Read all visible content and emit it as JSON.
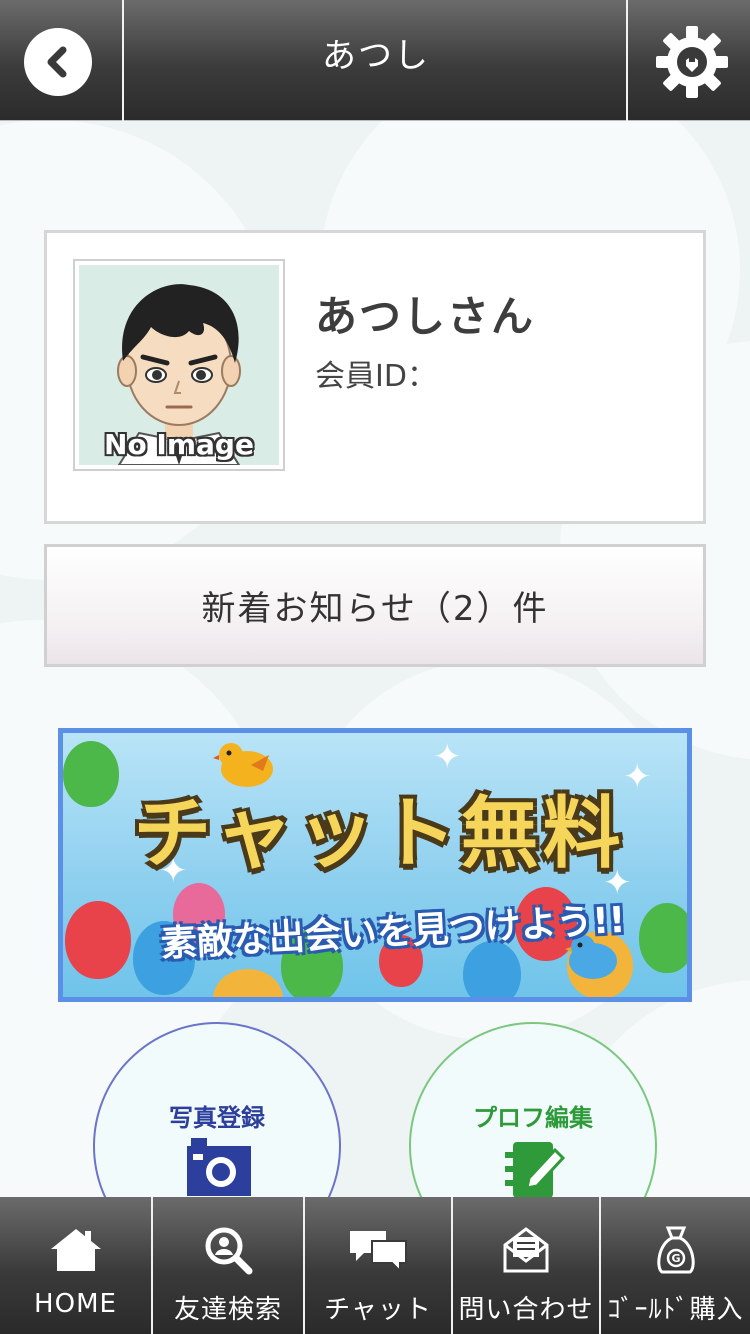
{
  "header": {
    "title": "あつし",
    "back_icon": "chevron-left-icon",
    "settings_icon": "gear-icon"
  },
  "profile": {
    "name": "あつしさん",
    "member_id_label": "会員ID：",
    "avatar_text": "No Image"
  },
  "news": {
    "label": "新着お知らせ（2）件"
  },
  "banner": {
    "headline": "チャット無料",
    "subline": "素敵な出会いを見つけよう!!"
  },
  "actions": [
    {
      "label": "写真登録",
      "icon": "camera-icon"
    },
    {
      "label": "プロフ編集",
      "icon": "edit-profile-icon"
    }
  ],
  "tabbar": [
    {
      "label": "HOME",
      "icon": "home-icon"
    },
    {
      "label": "友達検索",
      "icon": "search-user-icon"
    },
    {
      "label": "チャット",
      "icon": "chat-icon"
    },
    {
      "label": "問い合わせ",
      "icon": "mail-icon"
    },
    {
      "label": "ｺﾞｰﾙﾄﾞ購入",
      "icon": "gold-bag-icon"
    }
  ],
  "colors": {
    "header_bg": "#3c3c3c",
    "photo_accent": "#2d3f9d",
    "profile_accent": "#2e9a3a",
    "banner_border": "#5c8fe6"
  }
}
